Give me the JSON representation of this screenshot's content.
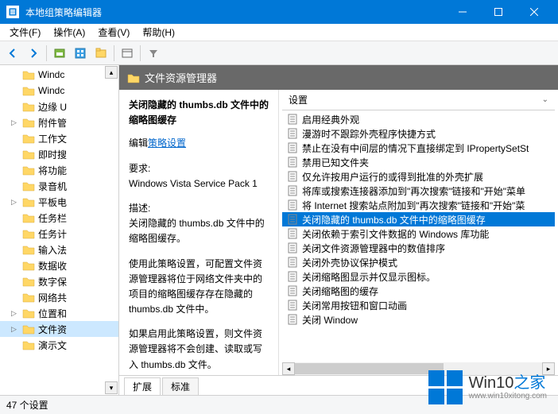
{
  "window": {
    "title": "本地组策略编辑器"
  },
  "menu": {
    "file": "文件(F)",
    "action": "操作(A)",
    "view": "查看(V)",
    "help": "帮助(H)"
  },
  "tree": {
    "items": [
      {
        "label": "Windc",
        "expander": ""
      },
      {
        "label": "Windc",
        "expander": ""
      },
      {
        "label": "边缘 U",
        "expander": ""
      },
      {
        "label": "附件管",
        "expander": "▷"
      },
      {
        "label": "工作文",
        "expander": ""
      },
      {
        "label": "即时搜",
        "expander": ""
      },
      {
        "label": "将功能",
        "expander": ""
      },
      {
        "label": "录音机",
        "expander": ""
      },
      {
        "label": "平板电",
        "expander": "▷"
      },
      {
        "label": "任务栏",
        "expander": ""
      },
      {
        "label": "任务计",
        "expander": ""
      },
      {
        "label": "输入法",
        "expander": ""
      },
      {
        "label": "数据收",
        "expander": ""
      },
      {
        "label": "数字保",
        "expander": ""
      },
      {
        "label": "网络共",
        "expander": ""
      },
      {
        "label": "位置和",
        "expander": "▷"
      },
      {
        "label": "文件资",
        "expander": "▷",
        "selected": true
      },
      {
        "label": "演示文",
        "expander": ""
      }
    ]
  },
  "header": {
    "title": "文件资源管理器"
  },
  "desc": {
    "title": "关闭隐藏的 thumbs.db 文件中的缩略图缓存",
    "edit_label": "编辑",
    "edit_link": "策略设置",
    "req_label": "要求:",
    "req_value": "Windows Vista Service Pack 1",
    "d_label": "描述:",
    "d_p1": "关闭隐藏的 thumbs.db 文件中的缩略图缓存。",
    "d_p2": "使用此策略设置，可配置文件资源管理器将位于网络文件夹中的项目的缩略图缓存存在隐藏的 thumbs.db 文件中。",
    "d_p3": "如果启用此策略设置，则文件资源管理器将不会创建、读取或写入 thumbs.db 文件。"
  },
  "settings": {
    "header": "设置",
    "items": [
      "启用经典外观",
      "漫游时不跟踪外壳程序快捷方式",
      "禁止在没有中间层的情况下直接绑定到 IPropertySetSt",
      "禁用已知文件夹",
      "仅允许按用户运行的或得到批准的外壳扩展",
      "将库或搜索连接器添加到\"再次搜索\"链接和\"开始\"菜单",
      "将 Internet 搜索站点附加到\"再次搜索\"链接和\"开始\"菜",
      "关闭隐藏的 thumbs.db 文件中的缩略图缓存",
      "关闭依赖于索引文件数据的 Windows 库功能",
      "关闭文件资源管理器中的数值排序",
      "关闭外壳协议保护模式",
      "关闭缩略图显示并仅显示图标。",
      "关闭缩略图的缓存",
      "关闭常用按钮和窗口动画",
      "关闭 Window"
    ],
    "selected_index": 7
  },
  "tabs": {
    "extended": "扩展",
    "standard": "标准"
  },
  "status": {
    "text": "47 个设置"
  },
  "watermark": {
    "brand_a": "Win10",
    "brand_b": "之家",
    "url": "www.win10xitong.com"
  }
}
